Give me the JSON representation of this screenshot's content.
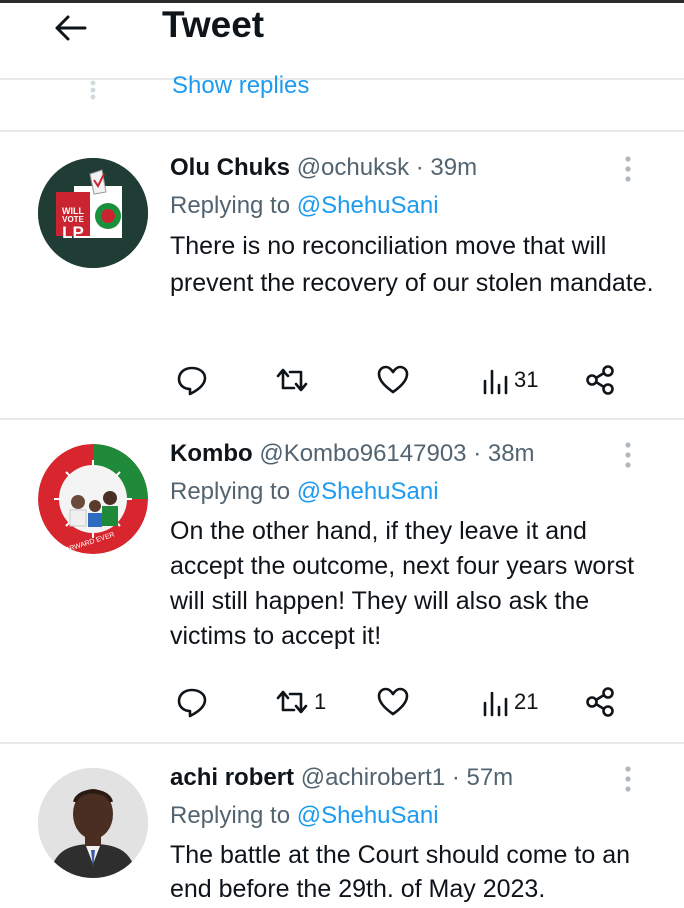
{
  "header": {
    "title": "Tweet",
    "back_icon": "arrow-left-icon"
  },
  "thread": {
    "show_replies_label": "Show replies"
  },
  "tweets": [
    {
      "name": "Olu Chuks",
      "handle": "@ochuksk",
      "time": "· 39m",
      "replying_prefix": "Replying to",
      "replying_to": "@ShehuSani",
      "text": "There is no reconciliation move that will prevent the recovery of our stolen mandate.",
      "retweets": "",
      "views": "31",
      "avatar_text_top": "I WILL VOTE",
      "avatar_text_bottom": "LP"
    },
    {
      "name": "Kombo",
      "handle": "@Kombo96147903",
      "time": "· 38m",
      "replying_prefix": "Replying to",
      "replying_to": "@ShehuSani",
      "text": "On the other hand, if they leave it and accept the outcome, next four years worst will still happen! They will also ask the victims to accept it!",
      "retweets": "1",
      "views": "21",
      "avatar_text": "FORWARD EVER"
    },
    {
      "name": "achi robert",
      "handle": "@achirobert1",
      "time": "· 57m",
      "replying_prefix": "Replying to",
      "replying_to": "@ShehuSani",
      "text": "The battle at the Court should come to an end before the 29th. of May 2023."
    }
  ],
  "colors": {
    "accent": "#1d9bf0",
    "text": "#0f1419",
    "muted": "#536471",
    "divider": "#e6e9ec"
  }
}
